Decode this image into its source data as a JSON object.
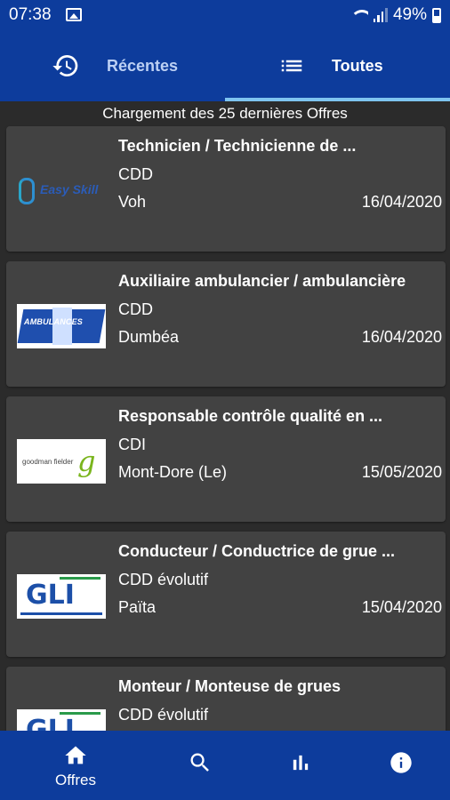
{
  "status_bar": {
    "time": "07:38",
    "battery": "49%",
    "icons": [
      "image-icon",
      "wifi-icon",
      "signal-icon",
      "battery-icon"
    ]
  },
  "tabs": [
    {
      "label": "Récentes",
      "icon": "history-icon",
      "selected": false
    },
    {
      "label": "Toutes",
      "icon": "list-icon",
      "selected": true
    }
  ],
  "loading_text": "Chargement des 25 dernières Offres",
  "offers": [
    {
      "title": "Technicien / Technicienne de ...",
      "type": "CDD",
      "place": "Voh",
      "date": "16/04/2020",
      "logo": "easy-skill-logo",
      "logo_text": "Easy Skill"
    },
    {
      "title": "Auxiliaire ambulancier / ambulancière",
      "type": "CDD",
      "place": "Dumbéa",
      "date": "16/04/2020",
      "logo": "ambulances-logo",
      "logo_text": "AMBULANCES"
    },
    {
      "title": "Responsable contrôle qualité en ...",
      "type": "CDI",
      "place": "Mont-Dore (Le)",
      "date": "15/05/2020",
      "logo": "goodman-fielder-logo",
      "logo_text": "goodman fielder"
    },
    {
      "title": "Conducteur / Conductrice de grue ...",
      "type": "CDD évolutif",
      "place": "Païta",
      "date": "15/04/2020",
      "logo": "gli-logo",
      "logo_text": "GLI"
    },
    {
      "title": "Monteur / Monteuse de grues",
      "type": "CDD évolutif",
      "place": "",
      "date": "",
      "logo": "gli-logo",
      "logo_text": "GLI"
    }
  ],
  "bottom_nav": [
    {
      "label": "Offres",
      "icon": "home-icon",
      "selected": true
    },
    {
      "label": "",
      "icon": "search-icon",
      "selected": false
    },
    {
      "label": "",
      "icon": "bar-chart-icon",
      "selected": false
    },
    {
      "label": "",
      "icon": "info-icon",
      "selected": false
    }
  ],
  "colors": {
    "primary": "#0d3c9c",
    "background": "#2b2b2b",
    "card": "#424242",
    "tab_indicator": "#7ec4f0"
  }
}
